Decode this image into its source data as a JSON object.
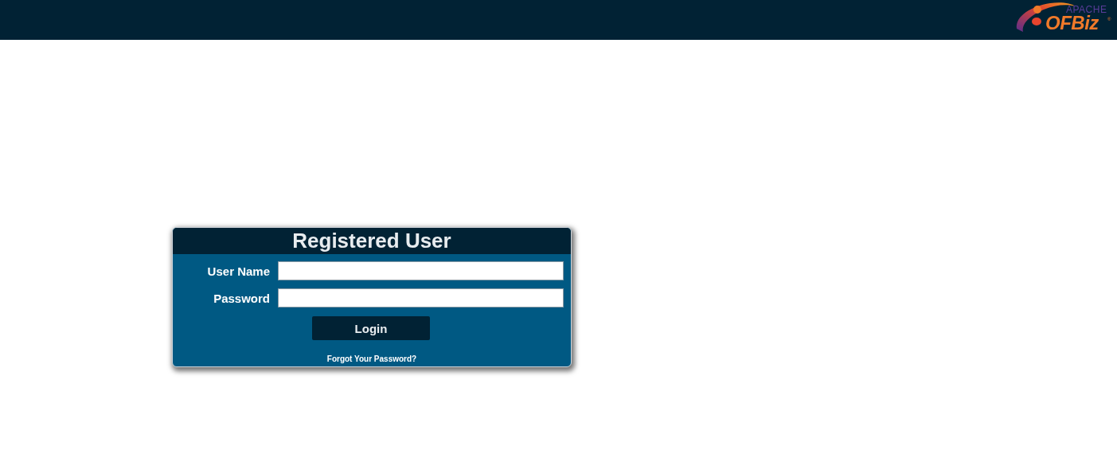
{
  "header": {
    "logo": {
      "overline": "APACHE",
      "name": "OFBiz",
      "mark": "®"
    }
  },
  "login": {
    "title": "Registered User",
    "fields": [
      {
        "label": "User Name"
      },
      {
        "label": "Password"
      }
    ],
    "button": "Login",
    "forgot_link": "Forgot Your Password?"
  }
}
